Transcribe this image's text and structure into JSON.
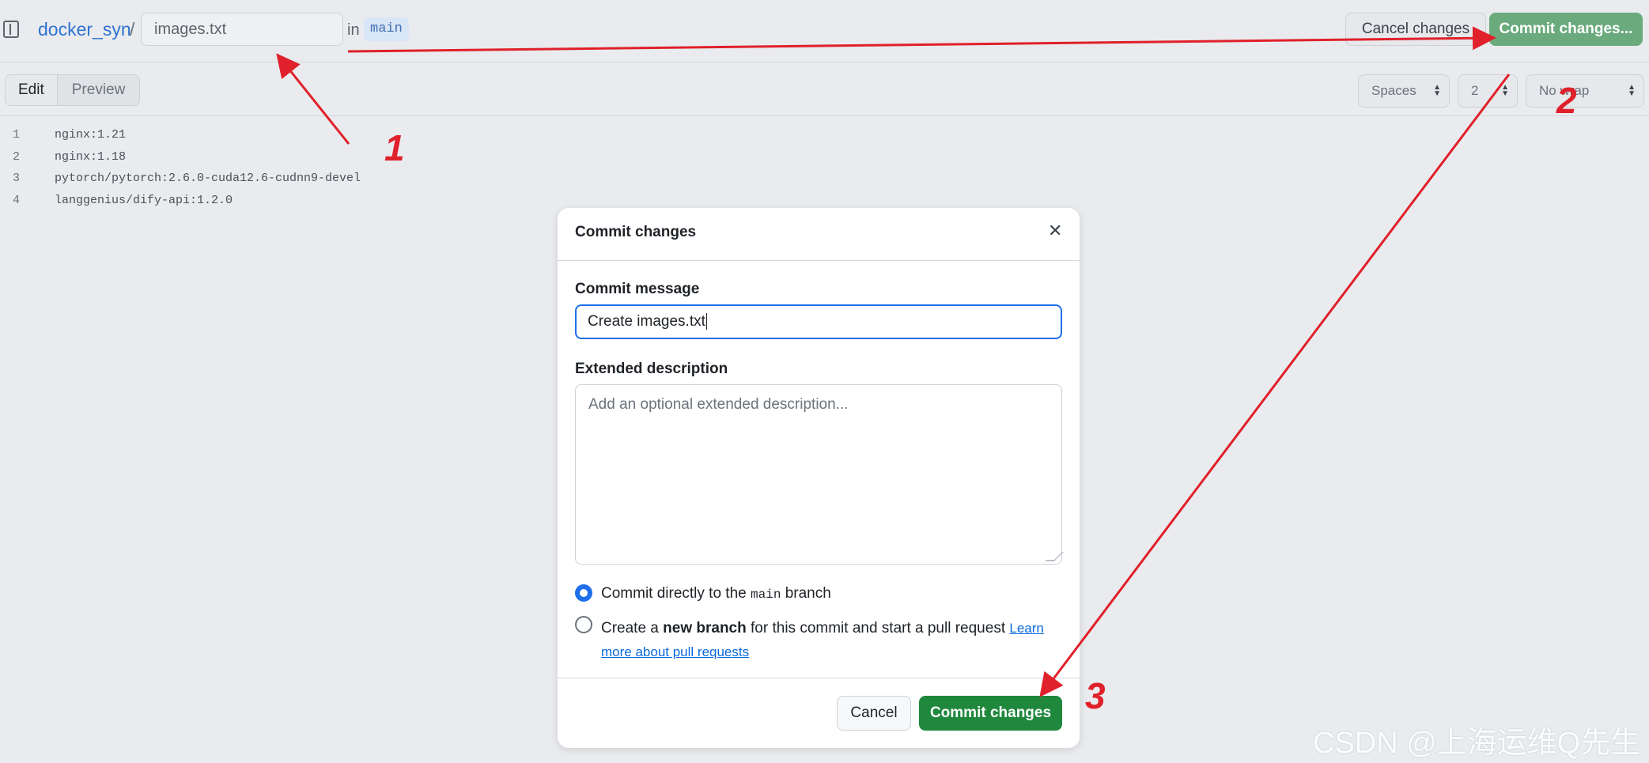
{
  "header": {
    "repo": "docker_syn",
    "separator": "/",
    "filename": "images.txt",
    "in_label": "in",
    "branch": "main",
    "cancel_label": "Cancel changes",
    "commit_label": "Commit changes..."
  },
  "toolbar": {
    "edit_label": "Edit",
    "preview_label": "Preview",
    "indent_mode": "Spaces",
    "indent_size": "2",
    "wrap_mode": "No wrap"
  },
  "editor": {
    "lines": [
      {
        "num": "1",
        "text": "nginx:1.21"
      },
      {
        "num": "2",
        "text": "nginx:1.18"
      },
      {
        "num": "3",
        "text": "pytorch/pytorch:2.6.0-cuda12.6-cudnn9-devel"
      },
      {
        "num": "4",
        "text": "langgenius/dify-api:1.2.0"
      }
    ]
  },
  "modal": {
    "title": "Commit changes",
    "message_label": "Commit message",
    "message_value": "Create images.txt",
    "description_label": "Extended description",
    "description_placeholder": "Add an optional extended description...",
    "option_direct_prefix": "Commit directly to the",
    "option_direct_branch": "main",
    "option_direct_suffix": "branch",
    "option_new_prefix": "Create a",
    "option_new_bold": "new branch",
    "option_new_suffix": "for this commit and start a pull request",
    "learn_more_1": "Learn",
    "learn_more_2": "more about pull requests",
    "cancel_label": "Cancel",
    "commit_label": "Commit changes"
  },
  "annotations": {
    "step1": "1",
    "step2": "2",
    "step3": "3",
    "color": "#e0202a"
  },
  "watermark": "CSDN @上海运维Q先生"
}
